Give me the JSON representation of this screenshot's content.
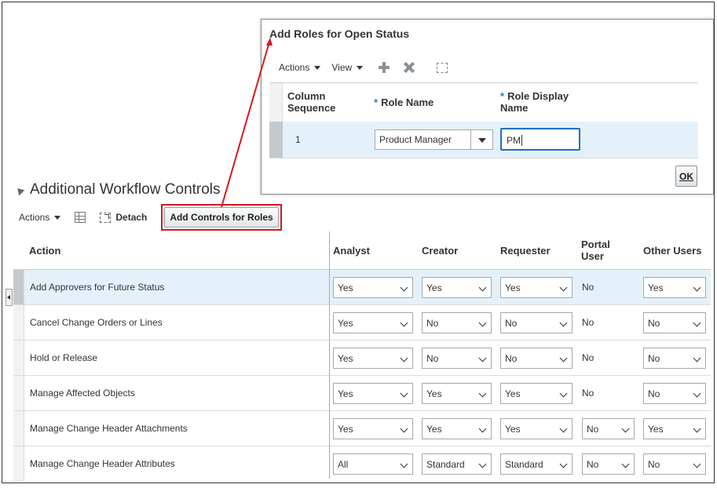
{
  "section": {
    "title": "Additional Workflow Controls"
  },
  "toolbar": {
    "actions": "Actions",
    "detach": "Detach",
    "add_controls": "Add Controls for Roles"
  },
  "table": {
    "headers": {
      "action": "Action",
      "analyst": "Analyst",
      "creator": "Creator",
      "requester": "Requester",
      "portal_user": "Portal User",
      "other_users": "Other Users"
    },
    "rows": [
      {
        "action": "Add Approvers for Future Status",
        "analyst": "Yes",
        "creator": "Yes",
        "requester": "Yes",
        "portal": "No",
        "other": "Yes"
      },
      {
        "action": "Cancel Change Orders or Lines",
        "analyst": "Yes",
        "creator": "No",
        "requester": "No",
        "portal": "No",
        "other": "No"
      },
      {
        "action": "Hold or Release",
        "analyst": "Yes",
        "creator": "No",
        "requester": "No",
        "portal": "No",
        "other": "No"
      },
      {
        "action": "Manage Affected Objects",
        "analyst": "Yes",
        "creator": "Yes",
        "requester": "Yes",
        "portal": "No",
        "other": "No"
      },
      {
        "action": "Manage Change Header Attachments",
        "analyst": "Yes",
        "creator": "Yes",
        "requester": "Yes",
        "portal": "No",
        "other": "Yes"
      },
      {
        "action": "Manage Change Header Attributes",
        "analyst": "All",
        "creator": "Standard",
        "requester": "Standard",
        "portal": "No",
        "other": "No"
      }
    ]
  },
  "dialog": {
    "title": "Add Roles for Open Status",
    "actions": "Actions",
    "view": "View",
    "headers": {
      "seq": "Column Sequence",
      "role_name": "Role Name",
      "role_display": "Role Display Name",
      "required_mark": "*"
    },
    "row": {
      "seq": "1",
      "role_name": "Product Manager",
      "role_display": "PM"
    },
    "ok": "OK"
  },
  "colors": {
    "callout": "#d7171f",
    "selected_row": "#e4f1fb",
    "focus_border": "#1f6fc1"
  }
}
